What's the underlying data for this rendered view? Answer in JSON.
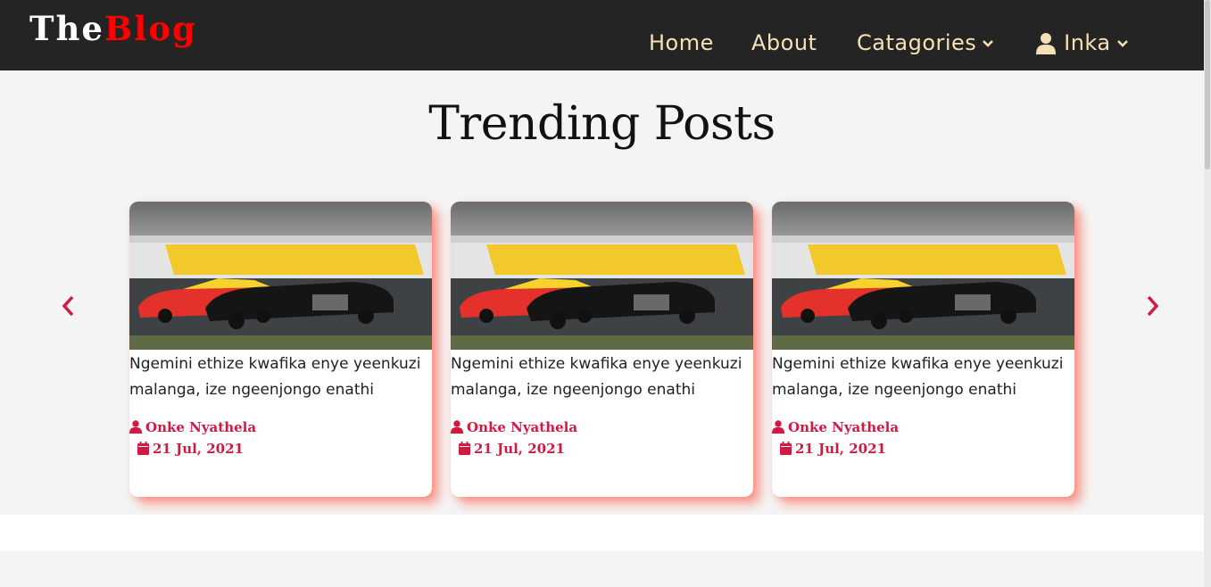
{
  "header": {
    "logo_part1": "The",
    "logo_part2": "Blog",
    "nav": {
      "home": "Home",
      "about": "About",
      "categories": "Catagories",
      "user": "Inka"
    }
  },
  "main": {
    "title": "Trending Posts"
  },
  "cards": [
    {
      "title": "Ngemini ethize kwafika enye yeenkuzi malanga, ize ngeenjongo enathi",
      "author": "Onke Nyathela",
      "date": "21 Jul, 2021"
    },
    {
      "title": "Ngemini ethize kwafika enye yeenkuzi malanga, ize ngeenjongo enathi",
      "author": "Onke Nyathela",
      "date": "21 Jul, 2021"
    },
    {
      "title": "Ngemini ethize kwafika enye yeenkuzi malanga, ize ngeenjongo enathi",
      "author": "Onke Nyathela",
      "date": "21 Jul, 2021"
    }
  ],
  "colors": {
    "navbar": "#242424",
    "nav_text": "#f6e0b5",
    "accent": "#d21942",
    "logo_red": "#ff0000"
  },
  "icons": {
    "prev": "chevron-left-icon",
    "next": "chevron-right-icon",
    "author": "user-icon",
    "date": "calendar-icon"
  }
}
